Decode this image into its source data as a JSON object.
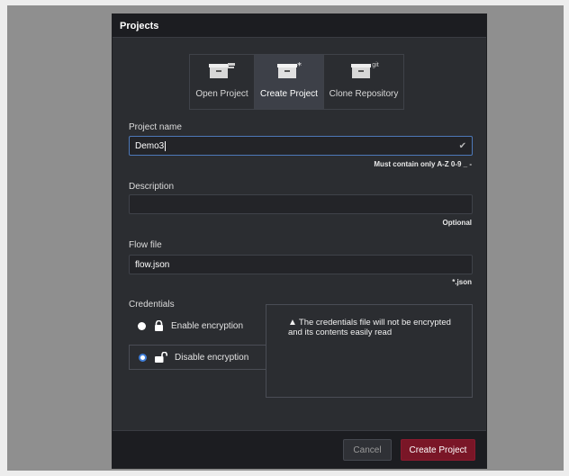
{
  "dialog": {
    "title": "Projects"
  },
  "tabs": [
    {
      "label": "Open Project",
      "icon": "box-open-icon",
      "active": false
    },
    {
      "label": "Create Project",
      "icon": "box-plus-icon",
      "active": true
    },
    {
      "label": "Clone Repository",
      "icon": "box-git-icon",
      "active": false,
      "badge": "git"
    }
  ],
  "project_name": {
    "label": "Project name",
    "value": "Demo3",
    "hint": "Must contain only A-Z 0-9 _ -"
  },
  "description": {
    "label": "Description",
    "value": "",
    "hint": "Optional"
  },
  "flow_file": {
    "label": "Flow file",
    "value": "flow.json",
    "hint": "*.json"
  },
  "credentials": {
    "label": "Credentials",
    "options": [
      {
        "label": "Enable encryption",
        "selected": false
      },
      {
        "label": "Disable encryption",
        "selected": true
      }
    ],
    "warning": "The credentials file will not be encrypted and its contents easily read"
  },
  "footer": {
    "cancel_label": "Cancel",
    "create_label": "Create Project"
  },
  "colors": {
    "accent": "#7a1627",
    "focus": "#4d78b8",
    "dialog_bg": "#2b2d31"
  }
}
